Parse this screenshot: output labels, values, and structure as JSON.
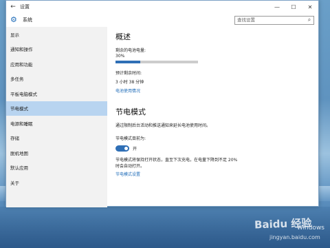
{
  "window": {
    "title": "设置",
    "back_glyph": "←",
    "minimize_glyph": "—",
    "maximize_glyph": "☐",
    "close_glyph": "✕"
  },
  "header": {
    "title": "系统",
    "search_placeholder": "查找设置",
    "accent_color": "#1e6bb8"
  },
  "sidebar": {
    "items": [
      {
        "label": "显示",
        "active": false
      },
      {
        "label": "通知和操作",
        "active": false
      },
      {
        "label": "应用和功能",
        "active": false
      },
      {
        "label": "多任务",
        "active": false
      },
      {
        "label": "平板电脑模式",
        "active": false
      },
      {
        "label": "节电模式",
        "active": true
      },
      {
        "label": "电源和睡眠",
        "active": false
      },
      {
        "label": "存储",
        "active": false
      },
      {
        "label": "脱机地图",
        "active": false
      },
      {
        "label": "默认应用",
        "active": false
      },
      {
        "label": "关于",
        "active": false
      }
    ]
  },
  "overview": {
    "heading": "概述",
    "battery_label": "剩余的电池电量:",
    "battery_percent_text": "30%",
    "battery_fraction": 0.3,
    "remaining_label": "预计剩余时间:",
    "remaining_value": "3 小时 38 分钟",
    "usage_link": "电池使用情况"
  },
  "battery_saver": {
    "heading": "节电模式",
    "description": "通过限制后台活动和推送通知来延长电池使用时间。",
    "status_label": "节电模式目前为:",
    "toggle_on": true,
    "toggle_text": "开",
    "note_line1": "节电模式将保持打开状态，直至下次充电，在电量下降到不足 20%",
    "note_line2": "时会自动打开。",
    "settings_link": "节电模式设置"
  },
  "desktop": {
    "activate_text": "Windows",
    "watermark": "Baidu 经验",
    "watermark_sub": "jingyan.baidu.com"
  }
}
